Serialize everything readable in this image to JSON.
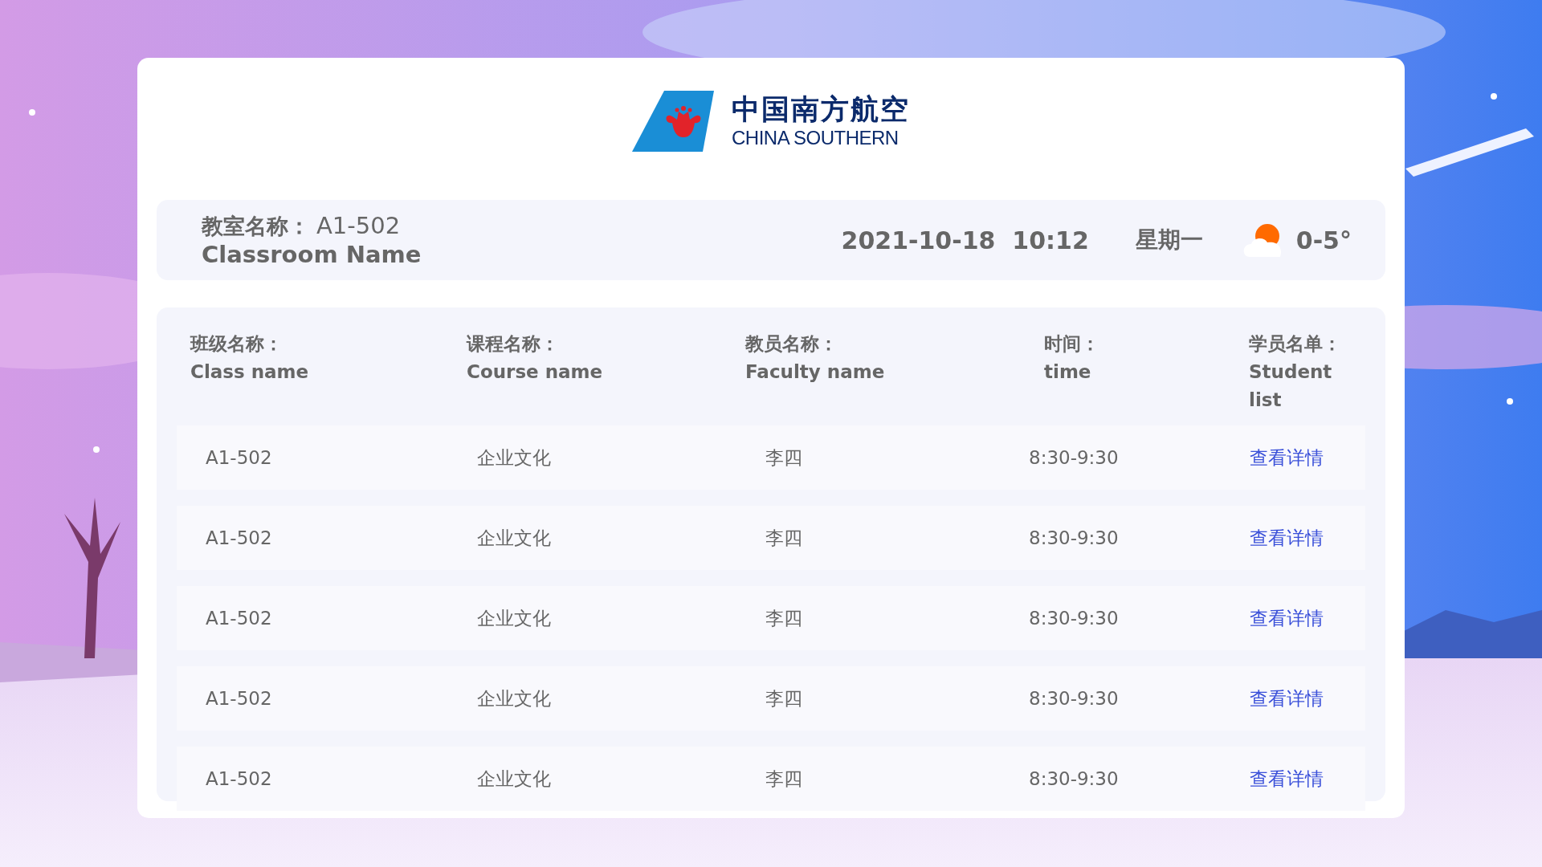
{
  "logo": {
    "name_zh": "中国南方航空",
    "name_en": "CHINA SOUTHERN"
  },
  "header": {
    "room_label": "教室名称：",
    "room_value": "A1-502",
    "room_label_en": "Classroom Name",
    "datetime": "2021-10-18  10:12",
    "weekday": "星期一",
    "temperature": "0-5°"
  },
  "table": {
    "columns": [
      {
        "zh": "班级名称：",
        "en": "Class name"
      },
      {
        "zh": "课程名称：",
        "en": "Course name"
      },
      {
        "zh": "教员名称：",
        "en": "Faculty name"
      },
      {
        "zh": "时间：",
        "en": "time"
      },
      {
        "zh": "学员名单：",
        "en": "Student list"
      }
    ],
    "rows": [
      {
        "class": "A1-502",
        "course": "企业文化",
        "faculty": "李四",
        "time": "8:30-9:30",
        "link": "查看详情"
      },
      {
        "class": "A1-502",
        "course": "企业文化",
        "faculty": "李四",
        "time": "8:30-9:30",
        "link": "查看详情"
      },
      {
        "class": "A1-502",
        "course": "企业文化",
        "faculty": "李四",
        "time": "8:30-9:30",
        "link": "查看详情"
      },
      {
        "class": "A1-502",
        "course": "企业文化",
        "faculty": "李四",
        "time": "8:30-9:30",
        "link": "查看详情"
      },
      {
        "class": "A1-502",
        "course": "企业文化",
        "faculty": "李四",
        "time": "8:30-9:30",
        "link": "查看详情"
      }
    ]
  }
}
